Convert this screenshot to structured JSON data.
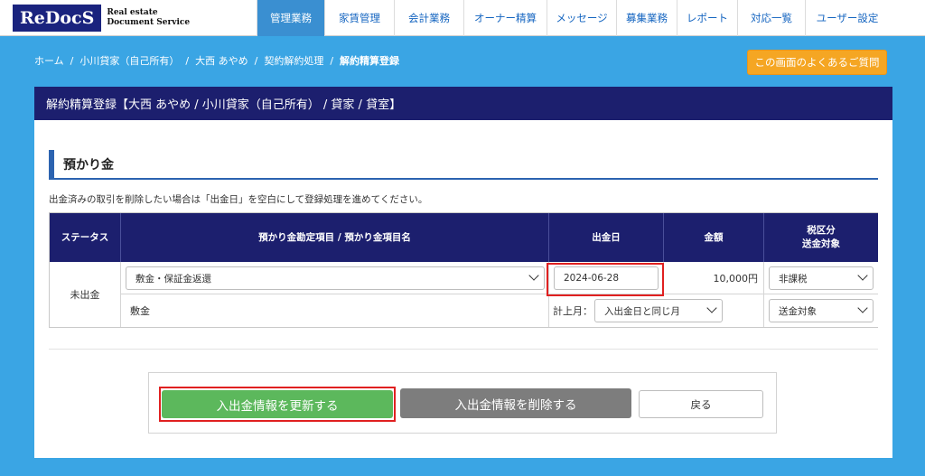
{
  "logo": {
    "re": "Re",
    "docs": "DocS",
    "tagline1": "Real estate",
    "tagline2": "Document Service"
  },
  "nav": [
    {
      "label": "管理業務",
      "active": true
    },
    {
      "label": "家賃管理"
    },
    {
      "label": "会計業務"
    },
    {
      "label": "オーナー精算"
    },
    {
      "label": "メッセージ"
    },
    {
      "label": "募集業務"
    },
    {
      "label": "レポート"
    },
    {
      "label": "対応一覧"
    },
    {
      "label": "ユーザー設定"
    }
  ],
  "breadcrumb": [
    "ホーム",
    "小川貸家（自己所有）",
    "大西 あやめ",
    "契約解約処理",
    "解約精算登録"
  ],
  "breadcrumb_sep": "/",
  "faq_label": "この画面のよくあるご質問",
  "panel_title": "解約精算登録【大西 あやめ / 小川貸家（自己所有） / 貸家 / 貸室】",
  "section_title": "預かり金",
  "note": "出金済みの取引を削除したい場合は「出金日」を空白にして登録処理を進めてください。",
  "table": {
    "headers": {
      "status": "ステータス",
      "item": "預かり金勘定項目 / 預かり金項目名",
      "date": "出金日",
      "amount": "金額",
      "tax_line1": "税区分",
      "tax_line2": "送金対象"
    },
    "row": {
      "status": "未出金",
      "item_select": "敷金・保証金返還",
      "item_name": "敷金",
      "date_value": "2024-06-28",
      "posting_label": "計上月：",
      "posting_select": "入出金日と同じ月",
      "amount": "10,000円",
      "tax_select": "非課税",
      "remit_select": "送金対象"
    }
  },
  "buttons": {
    "update": "入出金情報を更新する",
    "delete": "入出金情報を削除する",
    "back": "戻る"
  }
}
